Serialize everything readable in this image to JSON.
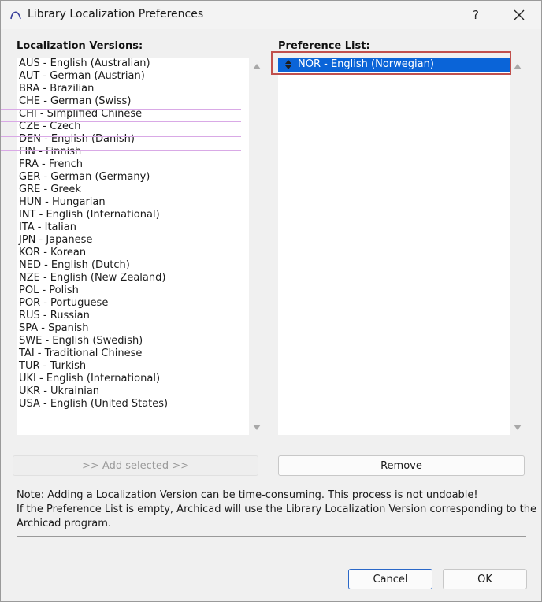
{
  "window": {
    "title": "Library Localization Preferences",
    "help_label": "?",
    "icons": {
      "app": "archicad-arc-icon",
      "close": "close-icon"
    }
  },
  "localization": {
    "label": "Localization Versions:",
    "items": [
      "AUS - English (Australian)",
      "AUT - German (Austrian)",
      "BRA - Brazilian",
      "CHE - German (Swiss)",
      "CHI - Simplified Chinese",
      "CZE - Czech",
      "DEN - English (Danish)",
      "FIN - Finnish",
      "FRA - French",
      "GER - German (Germany)",
      "GRE - Greek",
      "HUN - Hungarian",
      "INT - English (International)",
      "ITA - Italian",
      "JPN - Japanese",
      "KOR - Korean",
      "NED - English (Dutch)",
      "NZE - English (New Zealand)",
      "POL - Polish",
      "POR - Portuguese",
      "RUS - Russian",
      "SPA - Spanish",
      "SWE - English (Swedish)",
      "TAI - Traditional Chinese",
      "TUR - Turkish",
      "UKI - English (International)",
      "UKR - Ukrainian",
      "USA - English (United States)"
    ]
  },
  "preference": {
    "label": "Preference List:",
    "items": [
      "NOR - English (Norwegian)"
    ],
    "selected_index": 0,
    "highlight_color": "#c0504d",
    "selection_color": "#0a64d8"
  },
  "buttons": {
    "add_selected": ">> Add selected >>",
    "remove": "Remove",
    "cancel": "Cancel",
    "ok": "OK"
  },
  "note": {
    "line1": "Note: Adding a Localization Version can be time-consuming. This process is not undoable!",
    "line2": "If the Preference List is empty, Archicad will use the Library Localization Version corresponding to the",
    "line3": "Archicad program."
  }
}
